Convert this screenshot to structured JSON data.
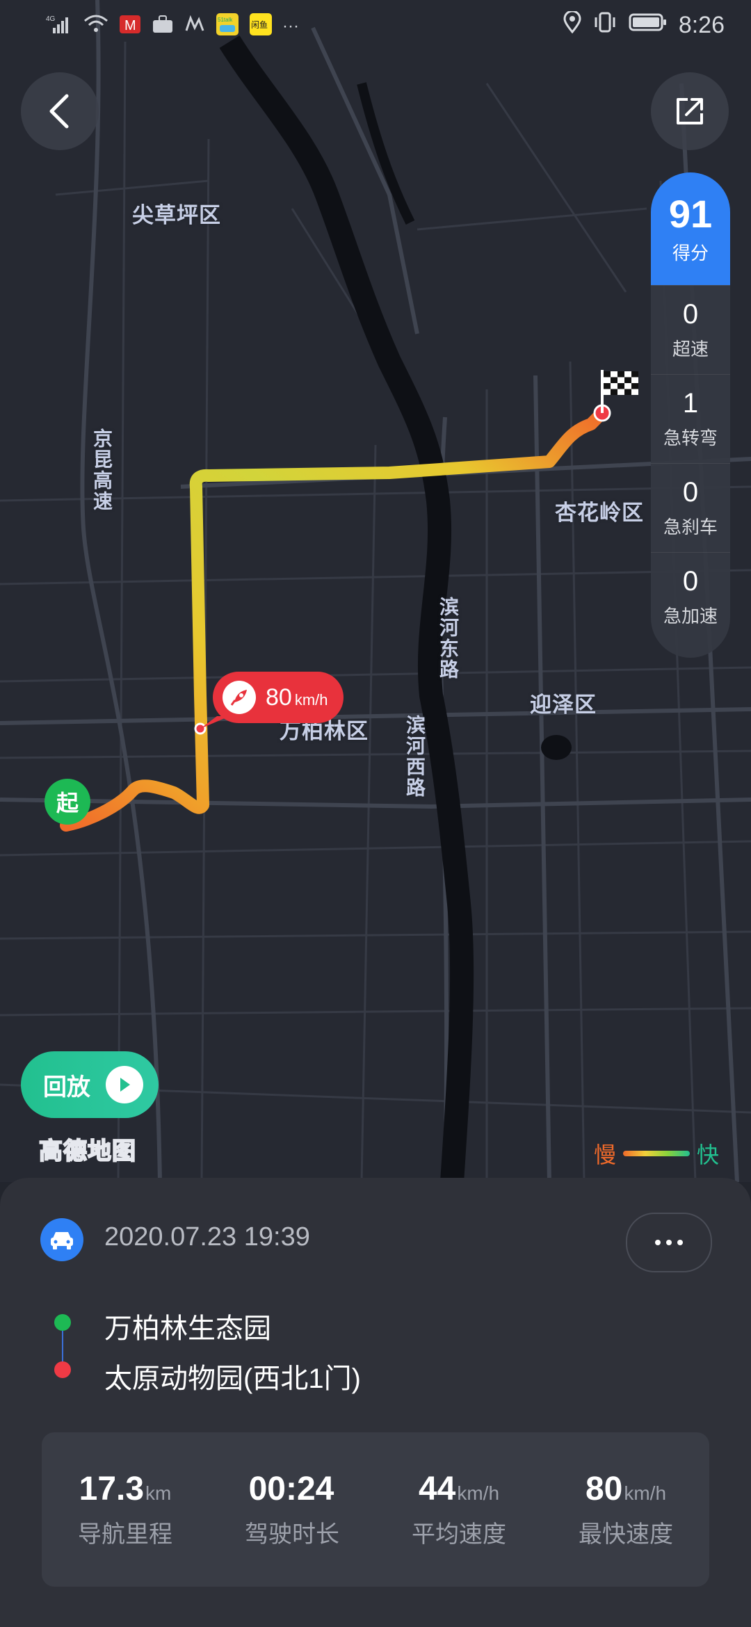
{
  "status_bar": {
    "network": "4G",
    "app_icons": [
      "51talk",
      "闲鱼"
    ],
    "more": "···",
    "time": "8:26"
  },
  "map": {
    "labels": [
      "尖草坪区",
      "杏花岭区",
      "万柏林区",
      "迎泽区"
    ],
    "roads": [
      "京昆高速",
      "滨河东路",
      "滨河西路"
    ],
    "start_marker": "起",
    "speed_bubble": {
      "value": "80",
      "unit": "km/h"
    },
    "logo": "高德地图"
  },
  "score_panel": {
    "score": "91",
    "score_label": "得分",
    "stats": [
      {
        "value": "0",
        "label": "超速"
      },
      {
        "value": "1",
        "label": "急转弯"
      },
      {
        "value": "0",
        "label": "急刹车"
      },
      {
        "value": "0",
        "label": "急加速"
      }
    ]
  },
  "replay_button": {
    "label": "回放"
  },
  "legend": {
    "slow": "慢",
    "fast": "快"
  },
  "trip": {
    "datetime": "2020.07.23 19:39",
    "from": "万柏林生态园",
    "to": "太原动物园(西北1门)",
    "summary": [
      {
        "value": "17.3",
        "unit": "km",
        "label": "导航里程"
      },
      {
        "value": "00:24",
        "unit": "",
        "label": "驾驶时长"
      },
      {
        "value": "44",
        "unit": "km/h",
        "label": "平均速度"
      },
      {
        "value": "80",
        "unit": "km/h",
        "label": "最快速度"
      }
    ]
  },
  "colors": {
    "accent_blue": "#2f80f4",
    "start_green": "#1db954",
    "end_red": "#ef3a45",
    "replay_green": "#22c08f",
    "slow_orange": "#f06a2a"
  }
}
